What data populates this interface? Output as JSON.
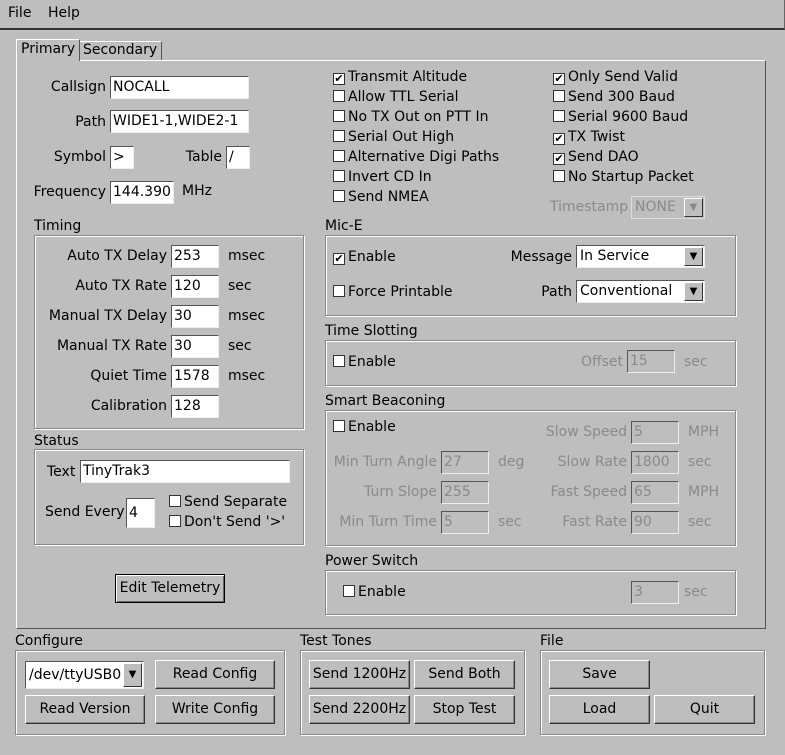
{
  "menu": {
    "file": "File",
    "help": "Help"
  },
  "tabs": {
    "primary": "Primary",
    "secondary": "Secondary"
  },
  "primary": {
    "callsign_label": "Callsign",
    "callsign": "NOCALL",
    "path_label": "Path",
    "path": "WIDE1-1,WIDE2-1",
    "symbol_label": "Symbol",
    "symbol": ">",
    "table_label": "Table",
    "table": "/",
    "frequency_label": "Frequency",
    "frequency": "144.390",
    "frequency_unit": "MHz"
  },
  "timing": {
    "title": "Timing",
    "rows": [
      {
        "label": "Auto TX Delay",
        "value": "253",
        "unit": "msec"
      },
      {
        "label": "Auto TX Rate",
        "value": "120",
        "unit": "sec"
      },
      {
        "label": "Manual TX Delay",
        "value": "30",
        "unit": "msec"
      },
      {
        "label": "Manual TX Rate",
        "value": "30",
        "unit": "sec"
      },
      {
        "label": "Quiet Time",
        "value": "1578",
        "unit": "msec"
      },
      {
        "label": "Calibration",
        "value": "128",
        "unit": ""
      }
    ]
  },
  "status": {
    "title": "Status",
    "text_label": "Text",
    "text": "TinyTrak3",
    "send_every_label": "Send Every",
    "send_every": "4",
    "send_separate": "Send Separate",
    "send_separate_checked": false,
    "dont_send": "Don't Send '>'",
    "dont_send_checked": false
  },
  "edit_telemetry": "Edit Telemetry",
  "options_left": [
    {
      "label": "Transmit Altitude",
      "checked": true
    },
    {
      "label": "Allow TTL Serial",
      "checked": false
    },
    {
      "label": "No TX Out on PTT In",
      "checked": false
    },
    {
      "label": "Serial Out High",
      "checked": false
    },
    {
      "label": "Alternative Digi Paths",
      "checked": false
    },
    {
      "label": "Invert CD In",
      "checked": false
    },
    {
      "label": "Send NMEA",
      "checked": false
    }
  ],
  "options_right": [
    {
      "label": "Only Send Valid",
      "checked": true
    },
    {
      "label": "Send 300 Baud",
      "checked": false
    },
    {
      "label": "Serial 9600 Baud",
      "checked": false
    },
    {
      "label": "TX Twist",
      "checked": true
    },
    {
      "label": "Send DAO",
      "checked": true
    },
    {
      "label": "No Startup Packet",
      "checked": false
    }
  ],
  "timestamp": {
    "label": "Timestamp",
    "value": "NONE"
  },
  "mic_e": {
    "title": "Mic-E",
    "enable": "Enable",
    "enable_checked": true,
    "message_label": "Message",
    "message": "In Service",
    "force_printable": "Force Printable",
    "force_printable_checked": false,
    "path_label": "Path",
    "path": "Conventional"
  },
  "time_slotting": {
    "title": "Time Slotting",
    "enable": "Enable",
    "enable_checked": false,
    "offset_label": "Offset",
    "offset": "15",
    "offset_unit": "sec"
  },
  "smart_beaconing": {
    "title": "Smart Beaconing",
    "enable": "Enable",
    "enable_checked": false,
    "left": [
      {
        "label": "Min Turn Angle",
        "value": "27",
        "unit": "deg"
      },
      {
        "label": "Turn Slope",
        "value": "255",
        "unit": ""
      },
      {
        "label": "Min Turn Time",
        "value": "5",
        "unit": "sec"
      }
    ],
    "right": [
      {
        "label": "Slow Speed",
        "value": "5",
        "unit": "MPH"
      },
      {
        "label": "Slow Rate",
        "value": "1800",
        "unit": "sec"
      },
      {
        "label": "Fast Speed",
        "value": "65",
        "unit": "MPH"
      },
      {
        "label": "Fast Rate",
        "value": "90",
        "unit": "sec"
      }
    ]
  },
  "power_switch": {
    "title": "Power Switch",
    "enable": "Enable",
    "enable_checked": false,
    "value": "3",
    "unit": "sec"
  },
  "configure": {
    "title": "Configure",
    "port": "/dev/ttyUSB0",
    "read_config": "Read Config",
    "read_version": "Read Version",
    "write_config": "Write Config"
  },
  "test_tones": {
    "title": "Test Tones",
    "send1200": "Send 1200Hz",
    "send_both": "Send Both",
    "send2200": "Send 2200Hz",
    "stop": "Stop Test"
  },
  "file": {
    "title": "File",
    "save": "Save",
    "load": "Load",
    "quit": "Quit"
  }
}
